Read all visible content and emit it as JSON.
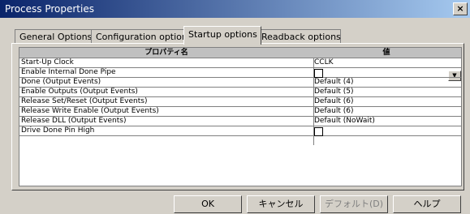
{
  "window": {
    "title": "Process Properties",
    "close_label": "×"
  },
  "tabs": [
    {
      "label": "General Options"
    },
    {
      "label": "Configuration options"
    },
    {
      "label": "Startup options",
      "active": true
    },
    {
      "label": "Readback options"
    }
  ],
  "table": {
    "headers": [
      "プロパティ名",
      "値"
    ],
    "rows": [
      {
        "name": "Start-Up Clock",
        "value": "CCLK"
      },
      {
        "name": "Enable Internal Done Pipe",
        "value": ""
      },
      {
        "name": "Done (Output Events)",
        "value": "Default (4)"
      },
      {
        "name": "Enable Outputs (Output Events)",
        "value": "Default (5)"
      },
      {
        "name": "Release Set/Reset (Output Events)",
        "value": "Default (6)"
      },
      {
        "name": "Release Write Enable (Output Events)",
        "value": "Default (6)"
      },
      {
        "name": "Release DLL (Output Events)",
        "value": "Default (NoWait)"
      },
      {
        "name": "Drive Done Pin High",
        "value": ""
      }
    ]
  },
  "buttons": {
    "ok": "OK",
    "cancel": "キャンセル",
    "default": "デフォルト(D)",
    "help": "ヘルプ"
  }
}
